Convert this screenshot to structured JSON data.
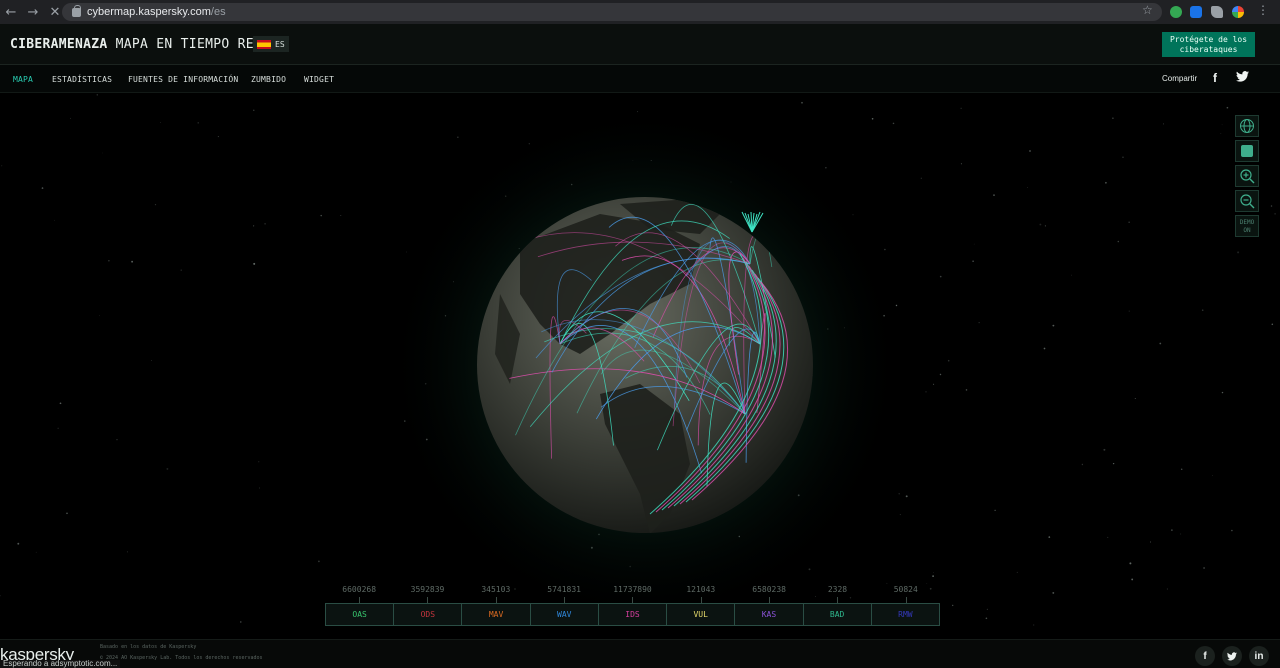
{
  "browser": {
    "url_host": "cybermap.kaspersky.com",
    "url_path": "/es"
  },
  "header": {
    "title_bold": "CIBERAMENAZA",
    "title_rest": "MAPA EN TIEMPO REAL",
    "language": "ES",
    "protect_button": "Protégete de los ciberataques"
  },
  "nav": {
    "items": [
      "MAPA",
      "ESTADÍSTICAS",
      "FUENTES DE INFORMACIÓN",
      "ZUMBIDO",
      "WIDGET"
    ],
    "active": "MAPA",
    "share_label": "Compartir"
  },
  "controls": {
    "demo_label": "DEMO ON"
  },
  "stats": [
    {
      "label": "OAS",
      "value": "6600268",
      "color": "#38c46e"
    },
    {
      "label": "ODS",
      "value": "3592839",
      "color": "#c4353d"
    },
    {
      "label": "MAV",
      "value": "345103",
      "color": "#d96a22"
    },
    {
      "label": "WAV",
      "value": "5741831",
      "color": "#2f86d8"
    },
    {
      "label": "IDS",
      "value": "11737890",
      "color": "#d63e9e"
    },
    {
      "label": "VUL",
      "value": "121043",
      "color": "#e4d96b"
    },
    {
      "label": "KAS",
      "value": "6580238",
      "color": "#8a52d6"
    },
    {
      "label": "BAD",
      "value": "2328",
      "color": "#2fb68c"
    },
    {
      "label": "RMW",
      "value": "50824",
      "color": "#3338b8"
    }
  ],
  "footer": {
    "logo": "kaspersky",
    "line1": "Basado en los datos de Kaspersky",
    "line2": "© 2024 AO Kaspersky Lab. Todos los derechos reservados",
    "status": "Esperando a adsymptotic.com..."
  },
  "colors": {
    "accent": "#29ccb1",
    "brand_green": "#00745a",
    "arc_teal": "#3fe3c4",
    "arc_pink": "#e24fb0",
    "arc_blue": "#4a9be8"
  }
}
